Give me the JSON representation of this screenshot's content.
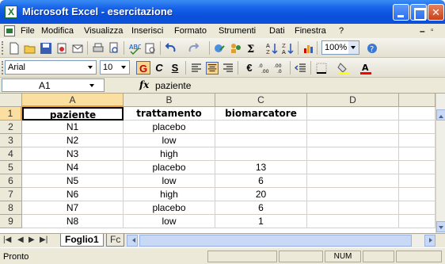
{
  "window": {
    "title": "Microsoft Excel - esercitazione"
  },
  "menu": [
    "File",
    "Modifica",
    "Visualizza",
    "Inserisci",
    "Formato",
    "Strumenti",
    "Dati",
    "Finestra",
    "?"
  ],
  "toolbar": {
    "zoom": "100%"
  },
  "format": {
    "font": "Arial",
    "size": "10",
    "bold": "G",
    "italic": "C",
    "underline": "S",
    "currency": "€"
  },
  "formula_bar": {
    "name_box": "A1",
    "fx": "fx",
    "content": "paziente"
  },
  "grid": {
    "columns": [
      "A",
      "B",
      "C",
      "D"
    ],
    "rows": [
      {
        "n": "1",
        "cells": [
          "paziente",
          "trattamento",
          "biomarcatore",
          ""
        ]
      },
      {
        "n": "2",
        "cells": [
          "N1",
          "placebo",
          "",
          ""
        ]
      },
      {
        "n": "3",
        "cells": [
          "N2",
          "low",
          "",
          ""
        ]
      },
      {
        "n": "4",
        "cells": [
          "N3",
          "high",
          "",
          ""
        ]
      },
      {
        "n": "5",
        "cells": [
          "N4",
          "placebo",
          "13",
          ""
        ]
      },
      {
        "n": "6",
        "cells": [
          "N5",
          "low",
          "6",
          ""
        ]
      },
      {
        "n": "7",
        "cells": [
          "N6",
          "high",
          "20",
          ""
        ]
      },
      {
        "n": "8",
        "cells": [
          "N7",
          "placebo",
          "6",
          ""
        ]
      },
      {
        "n": "9",
        "cells": [
          "N8",
          "low",
          "1",
          ""
        ]
      }
    ]
  },
  "sheets": {
    "active": "Foglio1",
    "next": "Fc"
  },
  "status": {
    "text": "Pronto",
    "num": "NUM"
  },
  "colors": {
    "title_blue": "#0a4fd8",
    "selection": "#fbdfa1"
  }
}
